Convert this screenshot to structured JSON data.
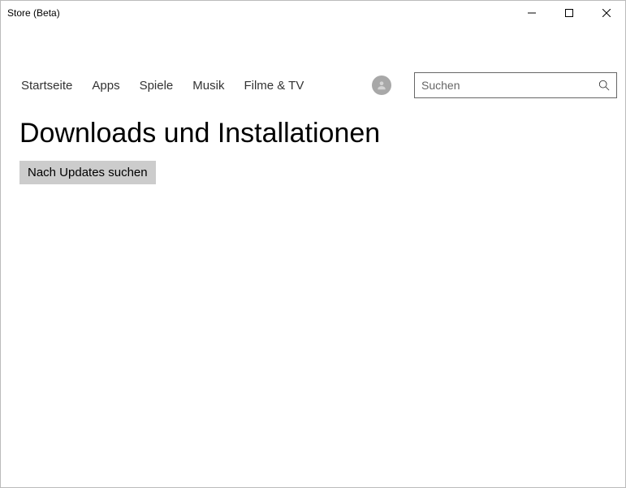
{
  "window": {
    "title": "Store (Beta)"
  },
  "nav": {
    "tabs": [
      {
        "label": "Startseite"
      },
      {
        "label": "Apps"
      },
      {
        "label": "Spiele"
      },
      {
        "label": "Musik"
      },
      {
        "label": "Filme & TV"
      }
    ]
  },
  "search": {
    "placeholder": "Suchen"
  },
  "page": {
    "title": "Downloads und Installationen",
    "update_button": "Nach Updates suchen"
  }
}
